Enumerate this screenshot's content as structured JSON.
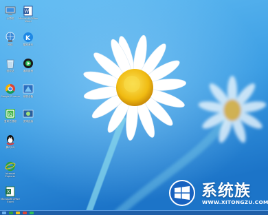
{
  "colors": {
    "sky_top": "#59b6f2",
    "sky_bottom": "#1d79cc",
    "petal": "#ffffff",
    "flower_center": "#f2c21a",
    "stem": "#7fd0e8",
    "taskbar": "#1f5fa8"
  },
  "desktop_icons": [
    {
      "name": "computer",
      "icon": "computer-icon",
      "label": "计算机"
    },
    {
      "name": "word",
      "icon": "word-icon",
      "label": "Microsoft Office Word"
    },
    {
      "name": "network",
      "icon": "network-icon",
      "label": "网络"
    },
    {
      "name": "kugou",
      "icon": "kugou-icon",
      "label": "酷狗音乐"
    },
    {
      "name": "recycle-bin",
      "icon": "recycle-bin-icon",
      "label": "回收站"
    },
    {
      "name": "media-player",
      "icon": "media-player-icon",
      "label": "暴风影音"
    },
    {
      "name": "chrome",
      "icon": "chrome-icon",
      "label": "Google Chrome"
    },
    {
      "name": "installer",
      "icon": "installer-icon",
      "label": "装机必备"
    },
    {
      "name": "iqiyi",
      "icon": "iqiyi-icon",
      "label": "爱奇艺视频"
    },
    {
      "name": "manager",
      "icon": "manager-icon",
      "label": "宽带连接"
    },
    {
      "name": "qq",
      "icon": "qq-icon",
      "label": "腾讯QQ"
    },
    {
      "name": "ie",
      "icon": "ie-icon",
      "label": "Internet Explorer"
    },
    {
      "name": "excel",
      "icon": "excel-icon",
      "label": "Microsoft Office Excel"
    }
  ],
  "watermark": {
    "title": "系统族",
    "url": "WWW.XITONGZU.COM",
    "logo": "windows-logo-icon"
  },
  "taskbar": {
    "items": [
      "start-icon",
      "ie-icon",
      "explorer-icon",
      "chrome-icon",
      "media-icon"
    ]
  }
}
